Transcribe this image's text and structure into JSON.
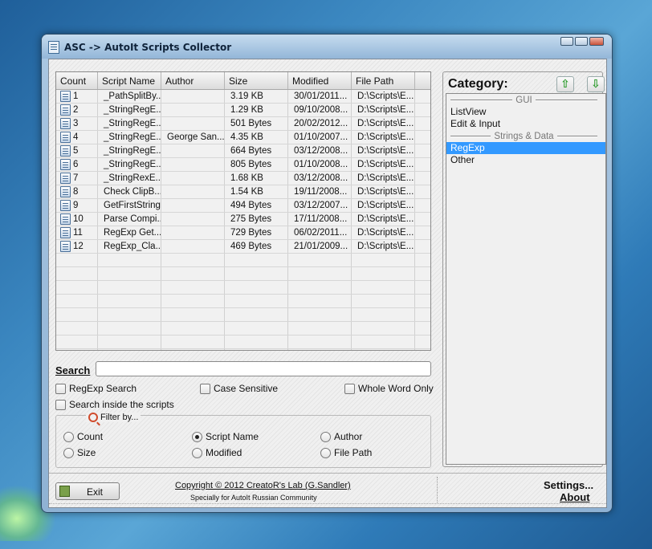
{
  "window": {
    "title": "ASC -> AutoIt Scripts Collector"
  },
  "listview": {
    "columns": [
      "Count",
      "Script Name",
      "Author",
      "Size",
      "Modified",
      "File Path"
    ],
    "rows": [
      [
        "1",
        "_PathSplitBy...",
        "",
        "3.19 KB",
        "30/01/2011...",
        "D:\\Scripts\\E..."
      ],
      [
        "2",
        "_StringRegE...",
        "",
        "1.29 KB",
        "09/10/2008...",
        "D:\\Scripts\\E..."
      ],
      [
        "3",
        "_StringRegE...",
        "",
        "501 Bytes",
        "20/02/2012...",
        "D:\\Scripts\\E..."
      ],
      [
        "4",
        "_StringRegE...",
        "George San...",
        "4.35 KB",
        "01/10/2007...",
        "D:\\Scripts\\E..."
      ],
      [
        "5",
        "_StringRegE...",
        "",
        "664 Bytes",
        "03/12/2008...",
        "D:\\Scripts\\E..."
      ],
      [
        "6",
        "_StringRegE...",
        "",
        "805 Bytes",
        "01/10/2008...",
        "D:\\Scripts\\E..."
      ],
      [
        "7",
        "_StringRexE...",
        "",
        "1.68 KB",
        "03/12/2008...",
        "D:\\Scripts\\E..."
      ],
      [
        "8",
        "Check ClipB...",
        "",
        "1.54 KB",
        "19/11/2008...",
        "D:\\Scripts\\E..."
      ],
      [
        "9",
        "GetFirstString",
        "",
        "494 Bytes",
        "03/12/2007...",
        "D:\\Scripts\\E..."
      ],
      [
        "10",
        "Parse Compi...",
        "",
        "275 Bytes",
        "17/11/2008...",
        "D:\\Scripts\\E..."
      ],
      [
        "11",
        "RegExp Get...",
        "",
        "729 Bytes",
        "06/02/2011...",
        "D:\\Scripts\\E..."
      ],
      [
        "12",
        "RegExp_Cla...",
        "",
        "469 Bytes",
        "21/01/2009...",
        "D:\\Scripts\\E..."
      ]
    ],
    "empty_rows": 8
  },
  "search": {
    "label": "Search",
    "value": "",
    "options": {
      "regexp": "RegExp Search",
      "case": "Case Sensitive",
      "whole_word": "Whole Word Only",
      "inside": "Search inside the scripts"
    }
  },
  "filter": {
    "legend": "Filter by...",
    "count": "Count",
    "script_name": "Script Name",
    "author": "Author",
    "size": "Size",
    "modified": "Modified",
    "file_path": "File Path",
    "selected": "Script Name"
  },
  "category": {
    "title": "Category:",
    "up_icon": "arrow-up-icon",
    "down_icon": "arrow-down-icon",
    "group_gui": "GUI",
    "listview": "ListView",
    "edit_input": "Edit & Input",
    "group_strings": "Strings & Data",
    "regexp": "RegExp",
    "other": "Other",
    "selected": "RegExp",
    "selected_color": "#3399ff"
  },
  "footer": {
    "exit": "Exit",
    "copyright": "Copyright © 2012 CreatoR's Lab (G.Sandler)",
    "community": "Specially for AutoIt Russian Community",
    "settings": "Settings...",
    "about": "About"
  }
}
